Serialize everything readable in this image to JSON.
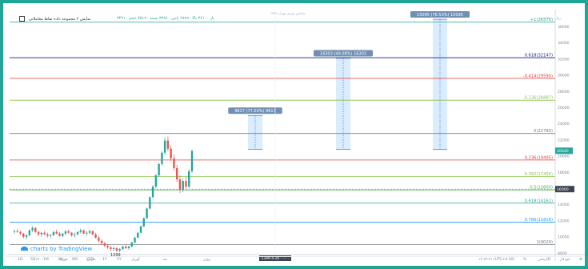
{
  "header": {
    "indicator_title": "نمایش ۲ مجموعه داده نقاط معاملاتی",
    "ohlc_text": "۳۴۲۱۰ باز ۳۶۱۰۰ بالا ۲۸۹۹۰ پایین ۳۲۸۶۰ بسته ۳۵۱۷۰ حجم",
    "symbol_text": "شاخص بورس تهران ۱۳۹۹",
    "right_text": "۲۸۰۰۰ ریال"
  },
  "fib_levels": [
    {
      "label": "+1(36570)",
      "value": 36570,
      "color": "#27a69a"
    },
    {
      "label": "0.618(32147)",
      "value": 32147,
      "color": "#1a237e"
    },
    {
      "label": "-0.414(29590)",
      "value": 29590,
      "color": "#e53935"
    },
    {
      "label": "-0.236(26887)",
      "value": 26887,
      "color": "#8bc34a"
    },
    {
      "label": "0(22780)",
      "value": 22780,
      "color": "#787b86"
    },
    {
      "label": "0.236(19495)",
      "value": 19495,
      "color": "#e53935"
    },
    {
      "label": "0.382(17456)",
      "value": 17456,
      "color": "#8bc34a"
    },
    {
      "label": "0.5(15800)",
      "value": 15800,
      "color": "#4caf50"
    },
    {
      "label": "0.618(14161)",
      "value": 14161,
      "color": "#27a69a"
    },
    {
      "label": "0.786(11816)",
      "value": 11816,
      "color": "#2196f3"
    },
    {
      "label": "1(9029)",
      "value": 9029,
      "color": "#787b86"
    }
  ],
  "price_ticks": [
    "36000",
    "34000",
    "32000",
    "30000",
    "28000",
    "26000",
    "24000",
    "22000",
    "20000",
    "18000",
    "16000",
    "14000",
    "12000",
    "10000",
    "8000"
  ],
  "price_range": [
    8000,
    37500
  ],
  "current_price_label": "20640",
  "current_price_value": 20640,
  "crosshair_price_label": "16000",
  "projections": [
    {
      "label": "9617 (77.03%) 9617",
      "top_value": 25000,
      "base_value": 20800
    },
    {
      "label": "16303 (49.08%) 16303",
      "top_value": 32100,
      "base_value": 20800
    },
    {
      "label": "15095 (76.53%) 15095",
      "top_value": 36900,
      "base_value": 20800
    }
  ],
  "candles": [
    [
      10.6,
      10.9,
      10.4,
      10.7
    ],
    [
      10.7,
      11.0,
      10.5,
      10.6
    ],
    [
      10.6,
      10.8,
      10.2,
      10.4
    ],
    [
      10.4,
      10.5,
      9.8,
      10.0
    ],
    [
      10.0,
      10.3,
      9.7,
      10.2
    ],
    [
      10.2,
      10.9,
      10.1,
      10.8
    ],
    [
      10.8,
      11.3,
      10.6,
      11.1
    ],
    [
      11.1,
      11.2,
      10.5,
      10.6
    ],
    [
      10.6,
      10.8,
      10.1,
      10.3
    ],
    [
      10.3,
      10.6,
      10.0,
      10.5
    ],
    [
      10.5,
      10.7,
      10.2,
      10.3
    ],
    [
      10.3,
      10.5,
      9.9,
      10.1
    ],
    [
      10.1,
      10.4,
      9.8,
      10.2
    ],
    [
      10.2,
      10.7,
      10.1,
      10.6
    ],
    [
      10.6,
      10.9,
      10.3,
      10.4
    ],
    [
      10.4,
      10.6,
      10.0,
      10.1
    ],
    [
      10.1,
      10.5,
      9.9,
      10.4
    ],
    [
      10.4,
      10.8,
      10.2,
      10.7
    ],
    [
      10.7,
      10.9,
      10.4,
      10.5
    ],
    [
      10.5,
      10.6,
      10.0,
      10.2
    ],
    [
      10.2,
      10.5,
      9.9,
      10.3
    ],
    [
      10.3,
      10.7,
      10.2,
      10.6
    ],
    [
      10.6,
      11.0,
      10.4,
      10.8
    ],
    [
      10.8,
      10.9,
      10.3,
      10.4
    ],
    [
      10.4,
      10.7,
      10.1,
      10.5
    ],
    [
      10.5,
      10.9,
      10.3,
      10.7
    ],
    [
      10.7,
      10.8,
      10.2,
      10.3
    ],
    [
      10.3,
      10.5,
      9.8,
      9.9
    ],
    [
      9.9,
      10.1,
      9.3,
      9.5
    ],
    [
      9.5,
      9.7,
      9.0,
      9.2
    ],
    [
      9.2,
      9.4,
      8.7,
      8.9
    ],
    [
      8.9,
      9.1,
      8.5,
      8.7
    ],
    [
      8.7,
      8.9,
      8.3,
      8.5
    ],
    [
      8.5,
      8.8,
      8.2,
      8.6
    ],
    [
      8.6,
      8.7,
      8.1,
      8.3
    ],
    [
      8.3,
      8.6,
      8.1,
      8.5
    ],
    [
      8.5,
      8.9,
      8.4,
      8.8
    ],
    [
      8.8,
      9.0,
      8.5,
      8.6
    ],
    [
      8.6,
      8.9,
      8.4,
      8.8
    ],
    [
      8.8,
      9.4,
      8.7,
      9.3
    ],
    [
      9.3,
      10.0,
      9.2,
      9.9
    ],
    [
      9.9,
      10.6,
      9.8,
      10.5
    ],
    [
      10.5,
      11.4,
      10.4,
      11.3
    ],
    [
      11.3,
      12.4,
      11.2,
      12.3
    ],
    [
      12.3,
      13.6,
      12.2,
      13.5
    ],
    [
      13.5,
      15.0,
      13.4,
      14.9
    ],
    [
      14.9,
      16.4,
      14.8,
      16.2
    ],
    [
      16.2,
      17.8,
      16.0,
      17.6
    ],
    [
      17.6,
      19.2,
      17.4,
      19.0
    ],
    [
      19.0,
      20.6,
      18.8,
      20.4
    ],
    [
      20.4,
      22.3,
      20.1,
      21.9
    ],
    [
      21.9,
      22.4,
      20.6,
      20.9
    ],
    [
      20.9,
      21.3,
      19.4,
      19.7
    ],
    [
      19.7,
      20.2,
      18.2,
      18.5
    ],
    [
      18.5,
      18.9,
      16.8,
      17.1
    ],
    [
      17.1,
      17.6,
      15.4,
      15.8
    ],
    [
      15.8,
      17.2,
      15.5,
      16.9
    ],
    [
      16.9,
      17.4,
      15.9,
      16.2
    ],
    [
      16.2,
      18.4,
      16.0,
      18.1
    ],
    [
      18.1,
      20.8,
      17.9,
      20.6
    ]
  ],
  "time_labels": [
    "۱۳۹۹",
    "۱۴۰۰",
    "فوریه",
    "مارس",
    "آوریل",
    "مه",
    "ژوئن"
  ],
  "time_cursor_label": "1399-4-26 ۰۰:۰۰",
  "year_marker": "1399",
  "logo_text": "charts by TradingView",
  "bottom_left_items": [
    "1D",
    "5D",
    "1M",
    "3M",
    "6M",
    "YTD",
    "1Y",
    "5Y"
  ],
  "bottom_right_items": [
    "۱۳:۲۲:۴۱ (UTC+4:30)",
    "%",
    "لگاریتمی",
    "خودکار",
    "⚙"
  ]
}
